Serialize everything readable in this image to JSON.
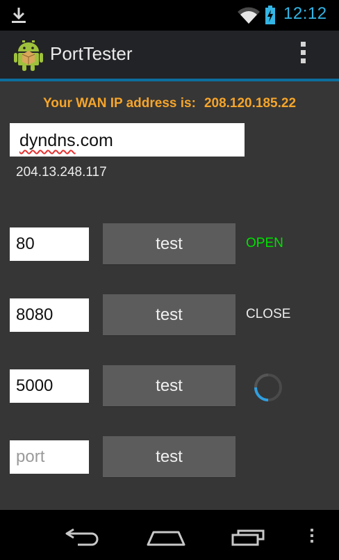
{
  "status_bar": {
    "time": "12:12",
    "accent_color": "#33b5e5",
    "icons": [
      "download-icon",
      "wifi-icon",
      "battery-charging-icon"
    ]
  },
  "action_bar": {
    "title": "PortTester",
    "app_icon": "android-icon",
    "overflow_icon": "overflow-menu-icon"
  },
  "wan": {
    "label": "Your WAN IP address is:",
    "ip": "208.120.185.22",
    "color": "#f6a52a"
  },
  "host": {
    "value_prefix": "",
    "value_underlined": "dyndns",
    "value_suffix": ".com",
    "resolved_ip": "204.13.248.117"
  },
  "rows": [
    {
      "port": "80",
      "button": "test",
      "status": "OPEN",
      "status_color": "#00e000"
    },
    {
      "port": "8080",
      "button": "test",
      "status": "CLOSE",
      "status_color": "#ececec"
    },
    {
      "port": "5000",
      "button": "test",
      "status": "",
      "loading": true
    },
    {
      "port": "",
      "placeholder": "port",
      "button": "test",
      "status": ""
    }
  ],
  "nav_bar": {
    "icons": [
      "back-icon",
      "home-icon",
      "recent-apps-icon",
      "menu-icon"
    ]
  }
}
